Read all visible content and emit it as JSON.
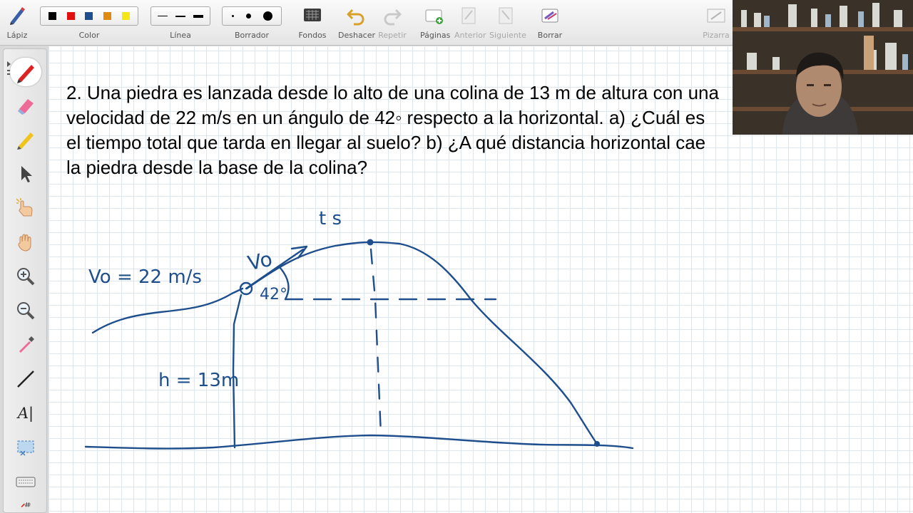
{
  "toolbar": {
    "pencil_label": "Lápiz",
    "color_label": "Color",
    "line_label": "Línea",
    "eraser_label": "Borrador",
    "backgrounds_label": "Fondos",
    "undo_label": "Deshacer",
    "redo_label": "Repetir",
    "pages_label": "Páginas",
    "previous_label": "Anterior",
    "next_label": "Siguiente",
    "clear_label": "Borrar",
    "whiteboard_label": "Pizarra",
    "colors": [
      "#000000",
      "#e01010",
      "#1f4f8f",
      "#e08a10",
      "#f5e61a"
    ]
  },
  "palette": {
    "tools": [
      "pen-tool",
      "highlighter-eraser",
      "highlighter",
      "select-arrow",
      "magic-pointer",
      "hand-pan",
      "zoom-in",
      "zoom-out",
      "eyedropper",
      "line-tool",
      "text-tool",
      "screen-capture",
      "keyboard",
      "table-tool"
    ],
    "text_tool_glyph": "A|"
  },
  "problem": {
    "text": "2. Una piedra es lanzada desde lo alto de una colina de 13 m de altura con una velocidad de 22 m/s en un ángulo de 42◦ respecto a la horizontal. a) ¿Cuál es el tiempo total que tarda en llegar al suelo? b) ¿A qué distancia horizontal cae la piedra desde la base de la colina?"
  },
  "annotations": {
    "velocity": "Vo = 22 m/s",
    "initial_velocity_vector": "Vo",
    "angle": "42°",
    "time": "t s",
    "height": "h = 13m"
  },
  "ink_color": "#1e4e8c"
}
